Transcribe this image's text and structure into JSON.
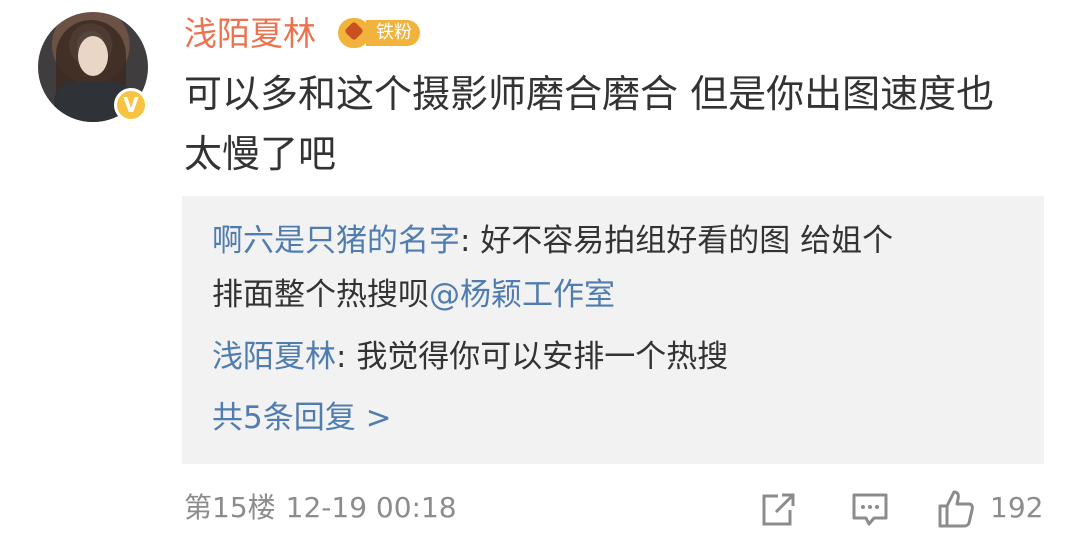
{
  "comment": {
    "username": "浅陌夏林",
    "fan_badge_label": "铁粉",
    "verified_mark": "V",
    "text_line1": "可以多和这个摄影师磨合磨合 但是你出图速度也",
    "text_line2": "太慢了吧",
    "replies": [
      {
        "author": "啊六是只猪的名字",
        "separator": ": ",
        "text_line1": "好不容易拍组好看的图 给姐个",
        "text_line2": "排面整个热搜呗",
        "mention": "@杨颖工作室"
      },
      {
        "author": "浅陌夏林",
        "separator": ": ",
        "text": "我觉得你可以安排一个热搜"
      }
    ],
    "more_replies": "共5条回复 >",
    "floor": "第15楼",
    "time": "12-19 00:18",
    "like_count": "192"
  },
  "icons": {
    "share": "share-icon",
    "comment": "comment-icon",
    "like": "thumbs-up-icon",
    "fan": "fan-badge-icon",
    "verified": "verified-badge-icon"
  },
  "colors": {
    "username": "#eb7350",
    "link": "#507daf",
    "meta": "#8c8c8c",
    "badge": "#f2b33d",
    "reply_background": "#f2f2f2"
  }
}
